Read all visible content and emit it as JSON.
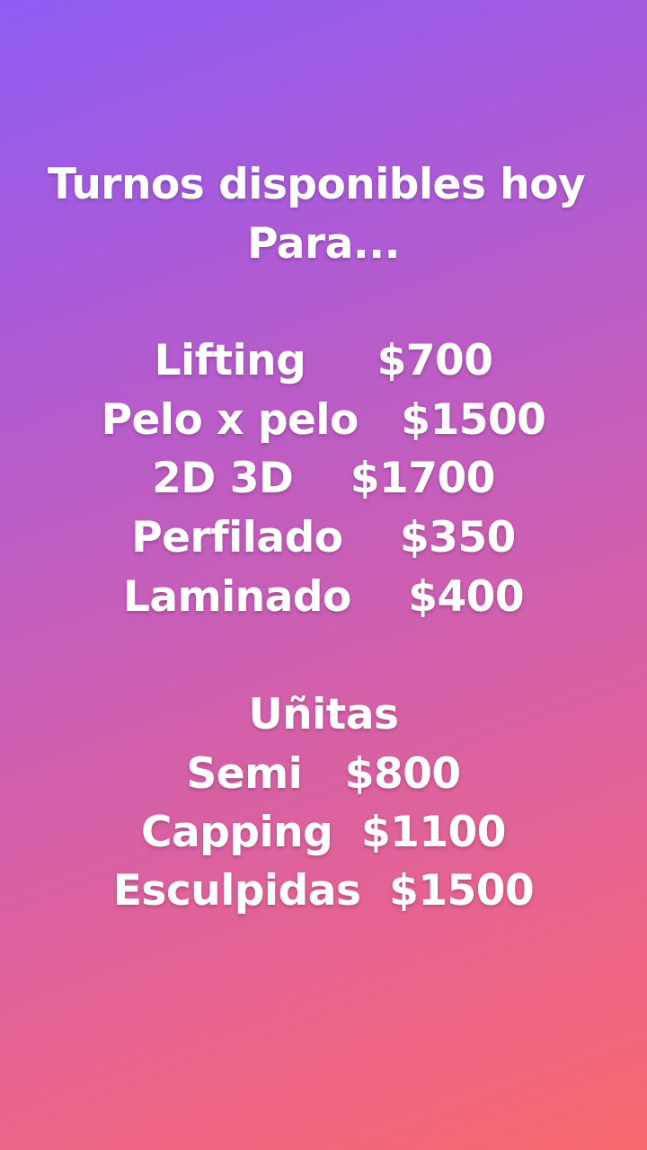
{
  "story": {
    "heading_line1": "Turnos disponibles hoy ",
    "heading_line2": "Para...",
    "services": [
      "Lifting     $700",
      "Pelo x pelo   $1500",
      "2D 3D    $1700",
      "Perfilado    $350",
      "Laminado    $400"
    ],
    "nails_heading": "Uñitas",
    "nails": [
      "Semi   $800",
      "Capping  $1100",
      "Esculpidas  $1500"
    ]
  },
  "colors": {
    "gradient_top": "#8e5cf2",
    "gradient_bottom": "#f86a6f",
    "text": "#ffffff"
  }
}
